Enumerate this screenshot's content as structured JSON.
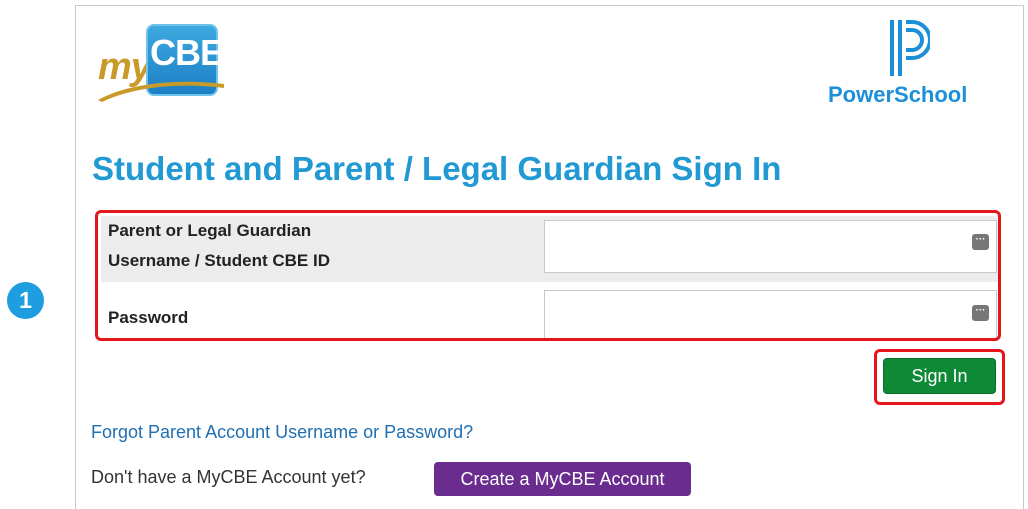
{
  "logos": {
    "mycbe": {
      "my_text": "my",
      "cbe_text": "CBE"
    },
    "powerschool": {
      "name": "PowerSchool"
    }
  },
  "page": {
    "title": "Student and Parent / Legal Guardian Sign In",
    "step_number": "1"
  },
  "form": {
    "username_label_line1": "Parent or Legal Guardian",
    "username_label_line2": "Username / Student CBE ID",
    "username_value": "",
    "password_label": "Password",
    "password_value": "",
    "password_manager_icon": "password-manager-icon"
  },
  "actions": {
    "sign_in_label": "Sign In",
    "forgot_link": "Forgot Parent Account Username or Password?",
    "no_account_text": "Don't have a MyCBE Account yet?",
    "create_account_label": "Create a MyCBE Account"
  },
  "colors": {
    "title_blue": "#2199d3",
    "highlight_red": "#e4151b",
    "sign_in_green": "#0e8a36",
    "create_purple": "#6a2c8f",
    "link_blue": "#1f6fb2",
    "powerschool_blue": "#1c8fd8"
  }
}
